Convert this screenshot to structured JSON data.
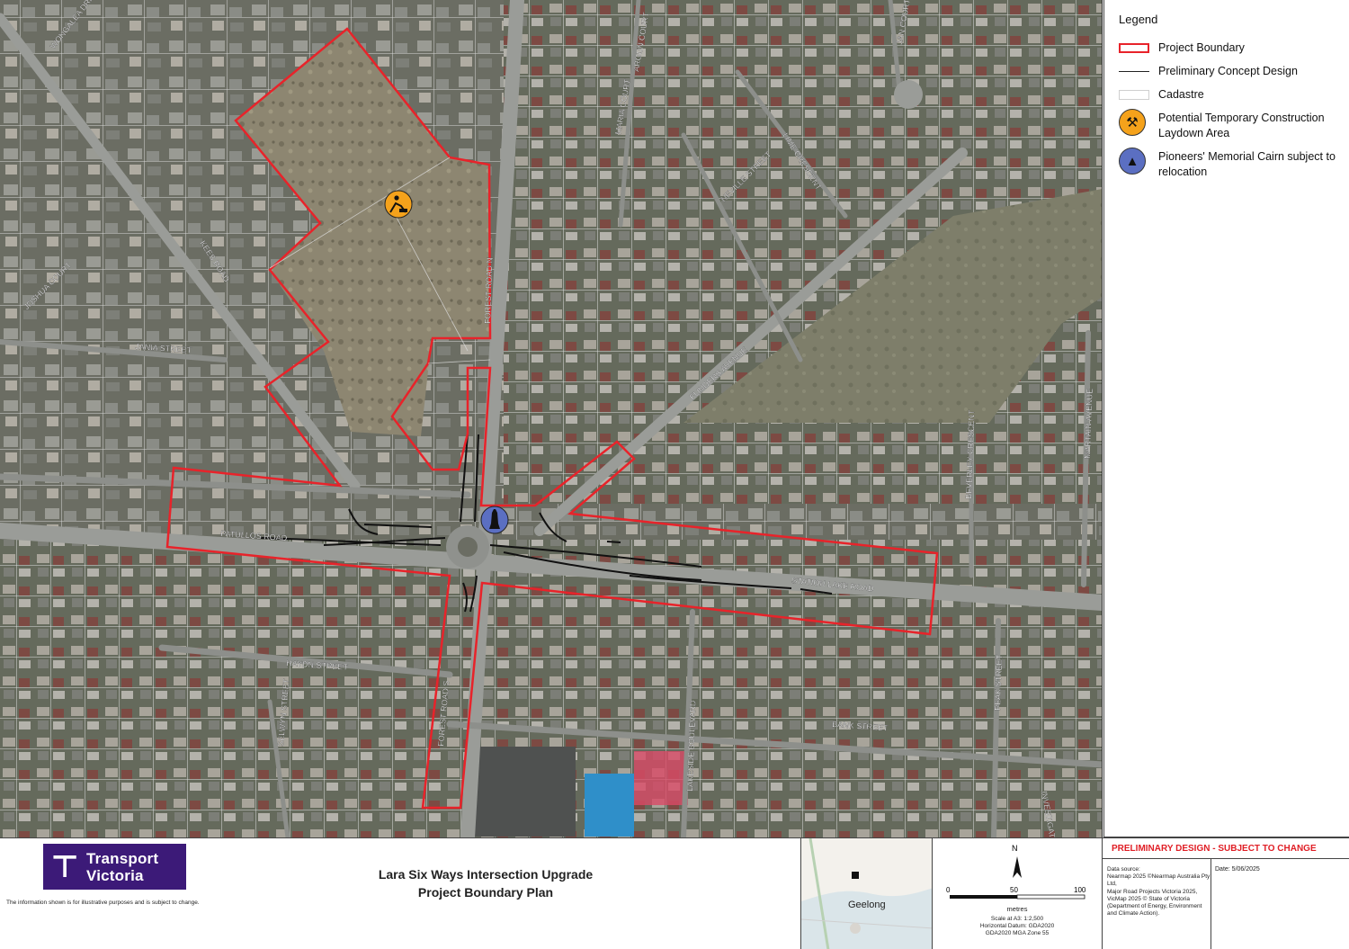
{
  "colors": {
    "boundary": "#e8232a",
    "design": "#111111",
    "cadastre": "#e5e5e5",
    "laydown": "#f5a21b",
    "cairn": "#5b6fc2",
    "brand": "#3c1a78",
    "notice": "#e01e25"
  },
  "map": {
    "street_labels": [
      "WONGALEA DRIVE",
      "KEES ROAD",
      "JOSHUA COURT",
      "JANIA STREET",
      "PATULLOS ROAD",
      "FOREST ROAD N",
      "FOREST ROAD S",
      "ARGUN COURT",
      "MARIA COURT",
      "JAN COURT",
      "LIME CRESCENT",
      "NEVILLE STREET",
      "FLINDERS AVENUE",
      "STATION LAKE ROAD",
      "BEVERLEY CRESCENT",
      "MARTAIN AVENUE",
      "HAYDN STREET",
      "SELWYN STREET",
      "BANK STREET",
      "LAKESIDE BOULEVARD",
      "PEAK STREET",
      "INVESTIGATOR DRIVE"
    ],
    "laydown_icon": "construction-worker-icon",
    "cairn_icon": "memorial-cairn-icon"
  },
  "legend": {
    "title": "Legend",
    "items": [
      {
        "label": "Project Boundary",
        "icon": "red-outline-box"
      },
      {
        "label": "Preliminary Concept Design",
        "icon": "black-line"
      },
      {
        "label": "Cadastre",
        "icon": "grey-outline-box"
      },
      {
        "label": "Potential Temporary Construction Laydown Area",
        "icon": "construction-worker-icon"
      },
      {
        "label": "Pioneers' Memorial Cairn subject to relocation",
        "icon": "memorial-cairn-icon"
      }
    ]
  },
  "footer": {
    "brand_line1": "Transport",
    "brand_line2": "Victoria",
    "disclaimer": "The information shown is for illustrative purposes and is subject to change.",
    "title_line1": "Lara Six Ways Intersection Upgrade",
    "title_line2": "Project Boundary Plan",
    "inset_place": "Geelong",
    "north_label": "N",
    "scale_ticks": [
      "0",
      "50",
      "100"
    ],
    "scale_unit": "metres",
    "scale_line1": "Scale at A3: 1:2,500",
    "scale_line2": "Horizontal Datum: GDA2020",
    "scale_line3": "GDA2020 MGA Zone 55",
    "notice": "PRELIMINARY DESIGN - SUBJECT TO CHANGE",
    "data_source": "Data source:\nNearmap 2025 ©Nearmap Australia Pty Ltd,\nMajor Road Projects Victoria 2025,\nVicMap 2025 © State of Victoria (Department of Energy, Environment and Climate Action).",
    "date": "Date: 5/06/2025"
  }
}
